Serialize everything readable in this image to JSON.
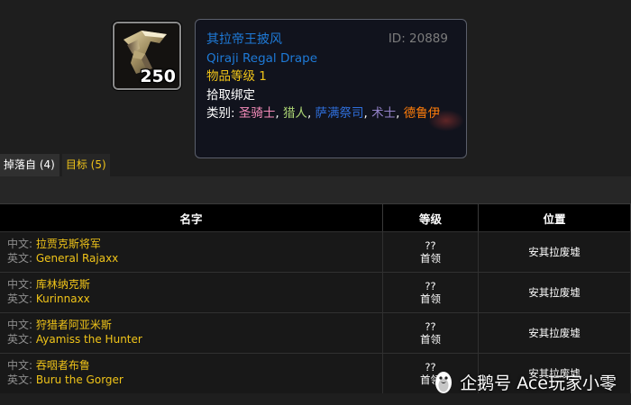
{
  "item": {
    "icon": "cloak-icon",
    "count": "250",
    "name_zh": "其拉帝王披风",
    "name_en": "Qiraji Regal Drape",
    "item_level": "物品等级 1",
    "bind": "拾取绑定",
    "id_label": "ID: 20889",
    "classes_label": "类别: ",
    "classes": [
      "圣骑士",
      "猎人",
      "萨满祭司",
      "术士",
      "德鲁伊"
    ],
    "separator": ", "
  },
  "colors": {
    "paladin": "#f58cba",
    "hunter": "#abd473",
    "shaman": "#2f6fdc",
    "warlock": "#9482c9",
    "druid": "#ff7d0a",
    "epic_name": "#1e7ad7",
    "gold": "#f0c419"
  },
  "tabs": [
    {
      "label": "掉落自 (4)",
      "active": true
    },
    {
      "label": "目标 (5)",
      "active": false
    }
  ],
  "table": {
    "headers": {
      "name": "名字",
      "level": "等级",
      "location": "位置"
    },
    "zh_prefix": "中文: ",
    "en_prefix": "英文: ",
    "rows": [
      {
        "zh": "拉贾克斯将军",
        "en": "General Rajaxx",
        "level": "??",
        "rank": "首领",
        "location": "安其拉废墟"
      },
      {
        "zh": "库林纳克斯",
        "en": "Kurinnaxx",
        "level": "??",
        "rank": "首领",
        "location": "安其拉废墟"
      },
      {
        "zh": "狩猎者阿亚米斯",
        "en": "Ayamiss the Hunter",
        "level": "??",
        "rank": "首领",
        "location": "安其拉废墟"
      },
      {
        "zh": "吞咽者布鲁",
        "en": "Buru the Gorger",
        "level": "??",
        "rank": "首领",
        "location": "安其拉废墟"
      }
    ]
  },
  "watermark": {
    "icon": "penguin-icon",
    "text": "企鹅号 Ace玩家小零"
  }
}
